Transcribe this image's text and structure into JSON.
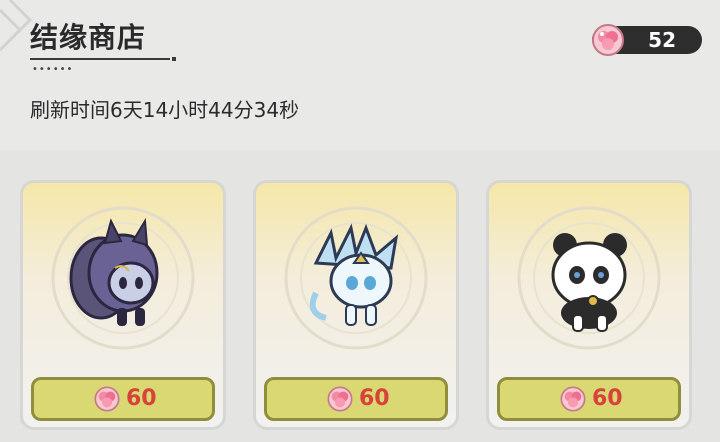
{
  "shop": {
    "title": "结缘商店",
    "dots": "••••••",
    "refresh_text": "刷新时间6天14小时44分34秒"
  },
  "currency": {
    "icon": "pink-gem-icon",
    "amount": "52"
  },
  "items": [
    {
      "name": "dark-nine-tailed-fox-pet",
      "price": "60",
      "icon": "pink-gem-icon"
    },
    {
      "name": "white-blue-dragon-fox-pet",
      "price": "60",
      "icon": "pink-gem-icon"
    },
    {
      "name": "panda-pet",
      "price": "60",
      "icon": "pink-gem-icon"
    }
  ],
  "colors": {
    "card_gradient_top": "#f5e7a8",
    "button_fill": "#d9d872",
    "price_red": "#d8423a",
    "currency_bg": "#2e2e2e"
  }
}
